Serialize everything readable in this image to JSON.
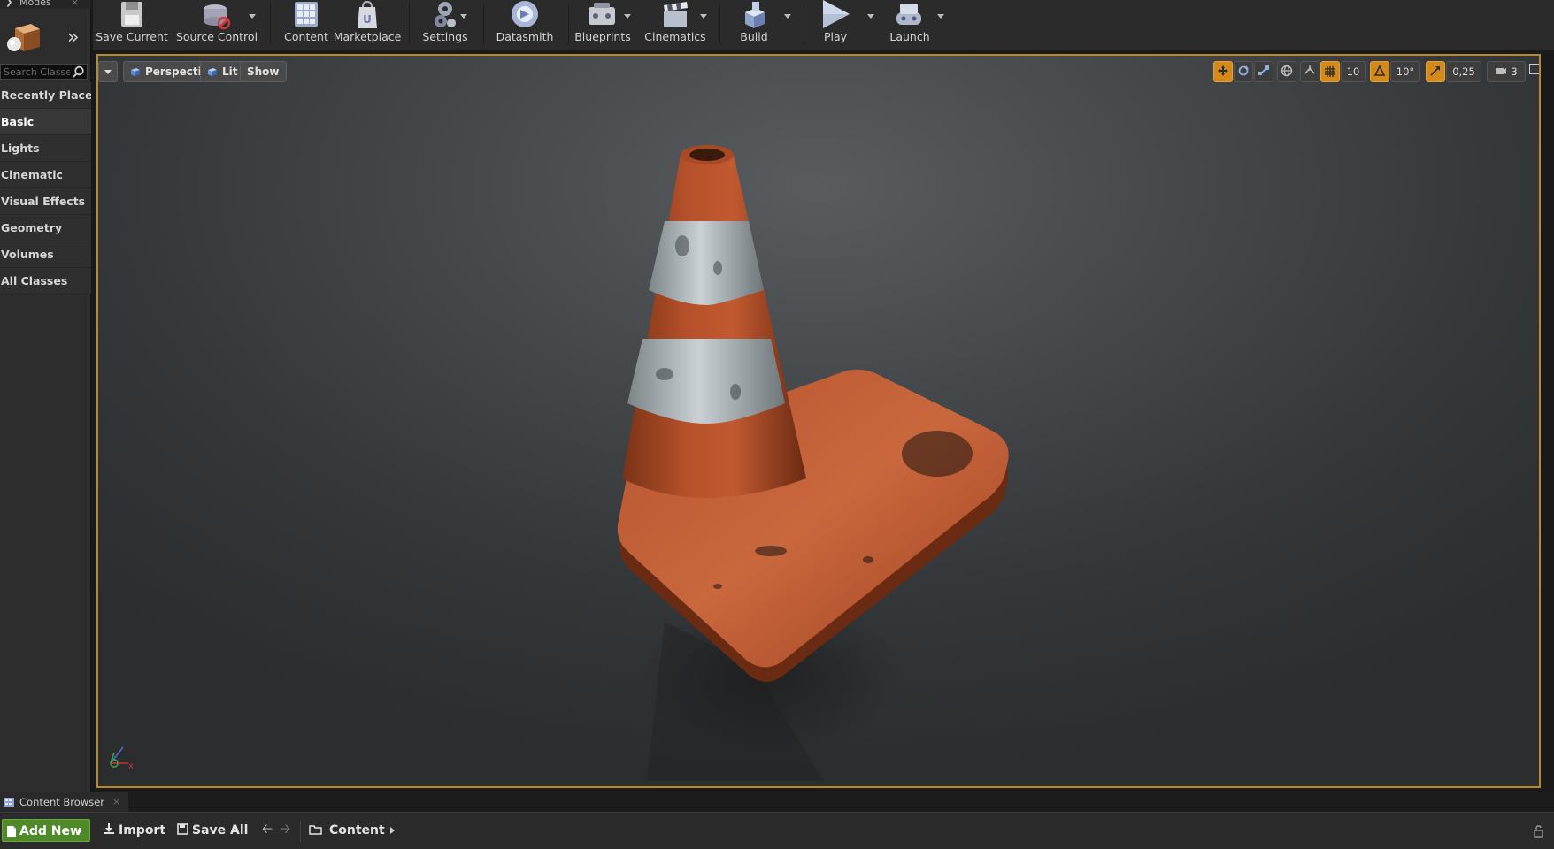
{
  "modes": {
    "tab_label": "Modes",
    "search_placeholder": "Search Classes",
    "categories": [
      {
        "label": "Recently Placed"
      },
      {
        "label": "Basic"
      },
      {
        "label": "Lights"
      },
      {
        "label": "Cinematic"
      },
      {
        "label": "Visual Effects"
      },
      {
        "label": "Geometry"
      },
      {
        "label": "Volumes"
      },
      {
        "label": "All Classes"
      }
    ],
    "active_category": "Basic"
  },
  "toolbar": {
    "save_current": "Save Current",
    "source_control": "Source Control",
    "content": "Content",
    "marketplace": "Marketplace",
    "settings": "Settings",
    "datasmith": "Datasmith",
    "blueprints": "Blueprints",
    "cinematics": "Cinematics",
    "build": "Build",
    "play": "Play",
    "launch": "Launch"
  },
  "viewport": {
    "perspective": "Perspective",
    "lit": "Lit",
    "show": "Show",
    "grid_snap": "10",
    "rotation_snap": "10°",
    "scale_snap": "0,25",
    "camera_speed": "3",
    "accent_color": "#d48a1a",
    "border_color": "#b98a2a"
  },
  "content_browser": {
    "tab_label": "Content Browser",
    "add_new": "Add New",
    "import": "Import",
    "save_all": "Save All",
    "path_root": "Content",
    "add_new_color": "#4f8a2a"
  }
}
